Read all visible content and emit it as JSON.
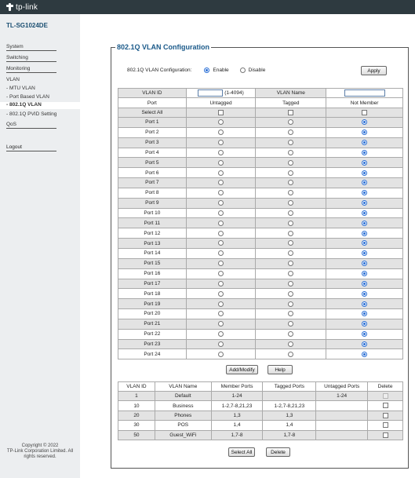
{
  "header": {
    "brand": "tp-link"
  },
  "sidebar": {
    "model": "TL-SG1024DE",
    "items": [
      "System",
      "Switching",
      "Monitoring",
      "VLAN"
    ],
    "vlan_sub": [
      "MTU VLAN",
      "Port Based VLAN",
      "802.1Q VLAN",
      "802.1Q PVID Setting"
    ],
    "qos": "QoS",
    "logout": "Logout",
    "copyright": [
      "Copyright © 2022",
      "TP-Link Corporation Limited. All",
      "rights reserved."
    ]
  },
  "main": {
    "title": "802.1Q VLAN Configuration",
    "config_label": "802.1Q VLAN Configuration:",
    "enable": "Enable",
    "disable": "Disable",
    "apply": "Apply",
    "vlan_id_label": "VLAN ID",
    "vlan_id_hint": "(1-4094)",
    "vlan_name_label": "VLAN Name",
    "col_port": "Port",
    "col_untagged": "Untagged",
    "col_tagged": "Tagged",
    "col_notmember": "Not Member",
    "select_all": "Select All",
    "ports": [
      "Port 1",
      "Port 2",
      "Port 3",
      "Port 4",
      "Port 5",
      "Port 6",
      "Port 7",
      "Port 8",
      "Port 9",
      "Port 10",
      "Port 11",
      "Port 12",
      "Port 13",
      "Port 14",
      "Port 15",
      "Port 16",
      "Port 17",
      "Port 18",
      "Port 19",
      "Port 20",
      "Port 21",
      "Port 22",
      "Port 23",
      "Port 24"
    ],
    "add_modify": "Add/Modify",
    "help": "Help",
    "vlan_table_headers": [
      "VLAN ID",
      "VLAN Name",
      "Member Ports",
      "Tagged Ports",
      "Untagged Ports",
      "Delete"
    ],
    "vlans": [
      {
        "id": "1",
        "name": "Default",
        "member": "1-24",
        "tagged": "",
        "untagged": "1-24"
      },
      {
        "id": "10",
        "name": "Business",
        "member": "1-2,7-8,21,23",
        "tagged": "1-2,7-8,21,23",
        "untagged": ""
      },
      {
        "id": "20",
        "name": "Phones",
        "member": "1,3",
        "tagged": "1,3",
        "untagged": ""
      },
      {
        "id": "30",
        "name": "POS",
        "member": "1,4",
        "tagged": "1,4",
        "untagged": ""
      },
      {
        "id": "50",
        "name": "Guest_WiFi",
        "member": "1,7-8",
        "tagged": "1,7-8",
        "untagged": ""
      }
    ],
    "select_all_btn": "Select All",
    "delete_btn": "Delete"
  }
}
